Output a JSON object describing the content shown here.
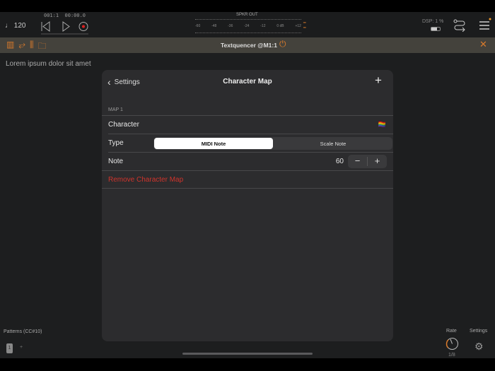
{
  "transport": {
    "tempo": "120",
    "position": "001:1",
    "time": "00:00.0"
  },
  "meter": {
    "label": "SPKR OUT",
    "ticks": [
      "-60",
      "-48",
      "-36",
      "-24",
      "-12",
      "0 dB",
      "+12"
    ]
  },
  "status": {
    "dsp": "DSP: 1 %"
  },
  "plugin": {
    "title": "Textquencer @M1:1"
  },
  "main": {
    "text": "Lorem ipsum dolor sit amet"
  },
  "dialog": {
    "back_label": "Settings",
    "title": "Character Map",
    "section": "MAP 1",
    "character_label": "Character",
    "character_value": "🏳️‍🌈",
    "type_label": "Type",
    "type_options": [
      "MIDI Note",
      "Scale Note"
    ],
    "type_selected": "MIDI Note",
    "note_label": "Note",
    "note_value": "60",
    "remove_label": "Remove Character Map"
  },
  "bottom": {
    "patterns_label": "Patterns (CC#10)",
    "pattern_selected": "1",
    "add": "+",
    "rate_label": "Rate",
    "rate_value": "1/8",
    "settings_label": "Settings"
  },
  "colors": {
    "accent": "#d97a2b",
    "destructive": "#d0342c"
  }
}
